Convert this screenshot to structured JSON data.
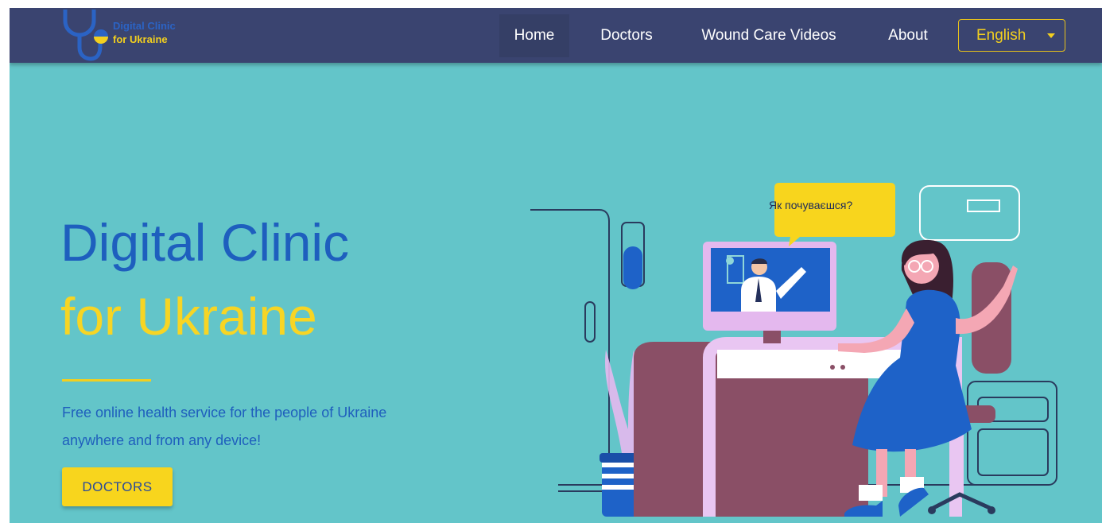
{
  "brand": {
    "line1": "Digital Clinic",
    "line2": "for Ukraine",
    "logo_icon": "stethoscope-icon"
  },
  "nav": {
    "items": [
      {
        "label": "Home",
        "active": true
      },
      {
        "label": "Doctors"
      },
      {
        "label": "Wound Care Videos"
      },
      {
        "label": "About"
      }
    ],
    "language": "English"
  },
  "hero": {
    "title_line1": "Digital Clinic",
    "title_line2": "for Ukraine",
    "description_line1": "Free online health service for the people of Ukraine",
    "description_line2": "anywhere and from any device!",
    "cta_label": "DOCTORS",
    "speech_bubble": "Як почуваєшся?"
  },
  "colors": {
    "navbar": "#3a4470",
    "hero_background": "#63c5c9",
    "brand_blue": "#1e5fbe",
    "brand_yellow": "#f7d524"
  }
}
